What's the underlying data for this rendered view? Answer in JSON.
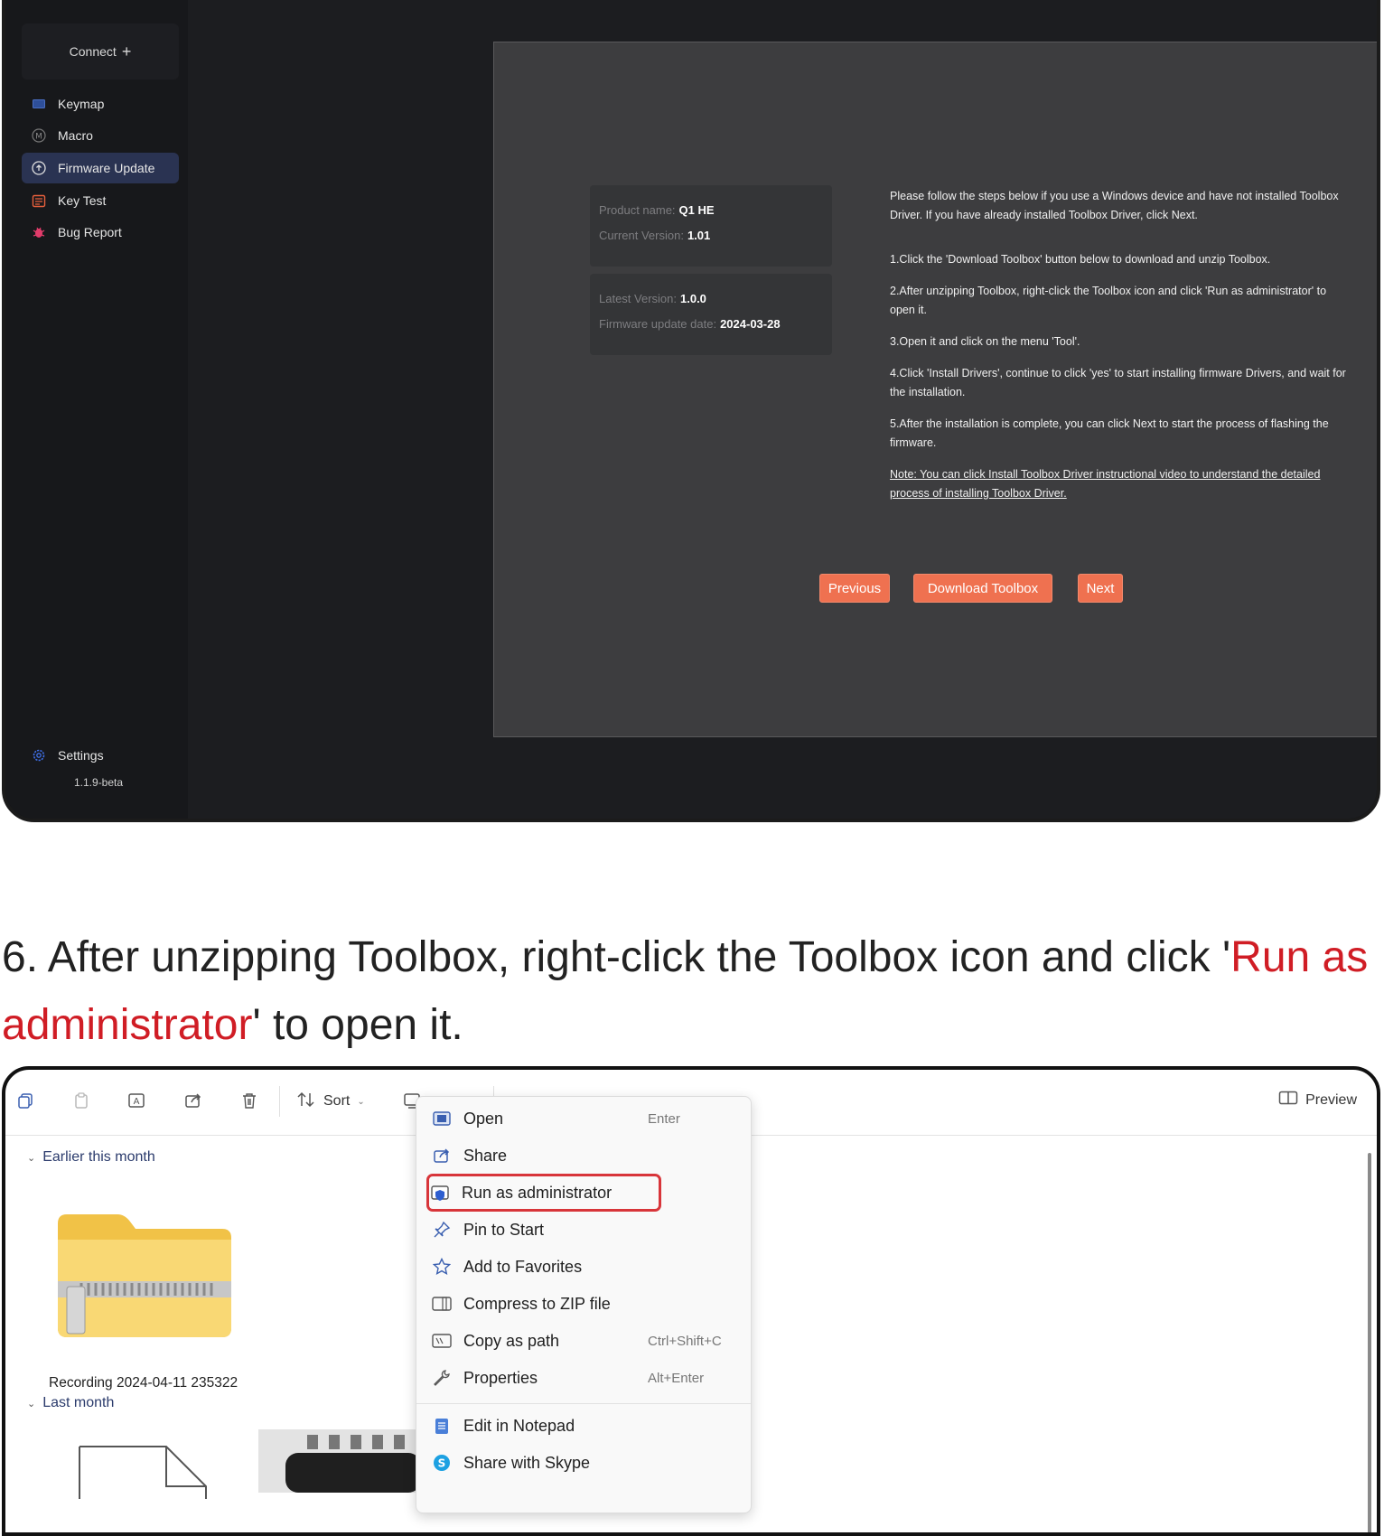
{
  "launcher": {
    "connect_label": "Connect",
    "connect_icon": "plus-icon",
    "nav": [
      {
        "label": "Keymap",
        "icon": "keyboard-icon"
      },
      {
        "label": "Macro",
        "icon": "macro-icon"
      },
      {
        "label": "Firmware Update",
        "icon": "firmware-update-icon",
        "active": true
      },
      {
        "label": "Key Test",
        "icon": "key-test-icon"
      },
      {
        "label": "Bug Report",
        "icon": "bug-icon"
      }
    ],
    "settings_label": "Settings",
    "version": "1.1.9-beta",
    "device": {
      "product_name_label": "Product name:",
      "product_name": "Q1 HE",
      "current_version_label": "Current Version:",
      "current_version": "1.01",
      "latest_version_label": "Latest Version:",
      "latest_version": "1.0.0",
      "update_date_label": "Firmware update date:",
      "update_date": "2024-03-28"
    },
    "instructions": {
      "intro": "Please follow the steps below if you use a Windows device and have not installed Toolbox Driver. If you have already installed Toolbox Driver, click Next.",
      "step1": "1.Click the 'Download Toolbox' button below to download and unzip Toolbox.",
      "step2": "2.After unzipping Toolbox, right-click the Toolbox icon and click 'Run as administrator' to open it.",
      "step3": "3.Open it and click on the menu 'Tool'.",
      "step4": "4.Click 'Install Drivers', continue to click 'yes' to start installing firmware Drivers, and wait for the installation.",
      "step5": "5.After the installation is complete, you can click Next to start the process of flashing the firmware.",
      "note": "Note: You can click Install Toolbox Driver instructional video to understand the detailed process of installing Toolbox Driver."
    },
    "buttons": {
      "previous": "Previous",
      "download": "Download Toolbox",
      "next": "Next"
    },
    "accent_color": "#ef7150"
  },
  "caption": {
    "before": "6. After unzipping Toolbox, right-click the Toolbox icon and click '",
    "highlight": "Run as administrator",
    "after": "' to open it.",
    "highlight_color": "#d01d25"
  },
  "explorer": {
    "sort_label": "Sort",
    "preview_label": "Preview",
    "group_earlier": "Earlier this month",
    "group_last": "Last month",
    "file_name": "Recording 2024-04-11 235322",
    "context_menu": [
      {
        "label": "Open",
        "shortcut": "Enter",
        "icon": "open-icon"
      },
      {
        "label": "Share",
        "shortcut": "",
        "icon": "share-icon"
      },
      {
        "label": "Run as administrator",
        "shortcut": "",
        "icon": "shield-admin-icon",
        "highlight": true
      },
      {
        "label": "Pin to Start",
        "shortcut": "",
        "icon": "pin-icon"
      },
      {
        "label": "Add to Favorites",
        "shortcut": "",
        "icon": "star-icon"
      },
      {
        "label": "Compress to ZIP file",
        "shortcut": "",
        "icon": "zip-icon"
      },
      {
        "label": "Copy as path",
        "shortcut": "Ctrl+Shift+C",
        "icon": "copy-path-icon"
      },
      {
        "label": "Properties",
        "shortcut": "Alt+Enter",
        "icon": "wrench-icon"
      },
      {
        "label": "Edit in Notepad",
        "shortcut": "",
        "icon": "notepad-icon"
      },
      {
        "label": "Share with Skype",
        "shortcut": "",
        "icon": "skype-icon"
      }
    ]
  }
}
